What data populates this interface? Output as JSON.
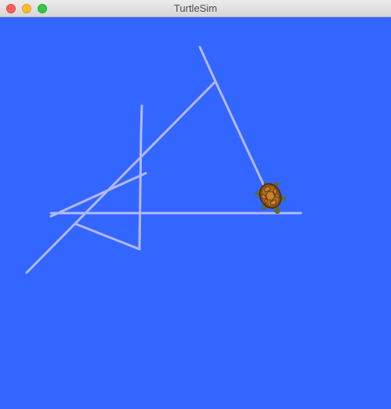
{
  "window": {
    "title": "TurtleSim",
    "buttons": {
      "close": "close-button",
      "minimize": "minimize-button",
      "zoom": "zoom-button"
    }
  },
  "canvas": {
    "background_color": "#3366ff",
    "pen_color": "#b3b8ff"
  },
  "turtle": {
    "icon": "turtle-icon",
    "shell_color": "#b06a1c",
    "skin_color": "#5d6b3a"
  }
}
